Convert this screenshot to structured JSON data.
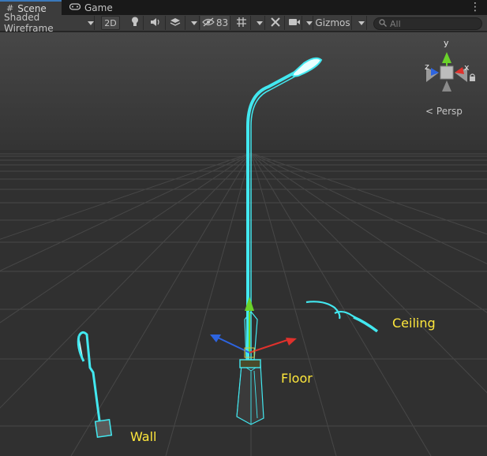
{
  "tabs": [
    {
      "label": "Scene",
      "icon": "hash-grid-icon",
      "active": true
    },
    {
      "label": "Game",
      "icon": "gamepad-icon",
      "active": false
    }
  ],
  "toolbar": {
    "shading_mode": "Shaded Wireframe",
    "mode_2d": "2D",
    "hidden_count": "83",
    "gizmos": "Gizmos",
    "search_placeholder": "All"
  },
  "scene": {
    "labels": {
      "ceiling": "Ceiling",
      "floor": "Floor",
      "wall": "Wall"
    },
    "orientation": {
      "y": "y",
      "x": "x",
      "z": "z",
      "projection": "Persp"
    }
  },
  "colors": {
    "background": "#282828",
    "grid": "#3f3f3f",
    "wire": "#42e8f0",
    "label": "#ffe83c",
    "axis_x": "#e0312c",
    "axis_y": "#6ad22a",
    "axis_z": "#2d64e0"
  }
}
